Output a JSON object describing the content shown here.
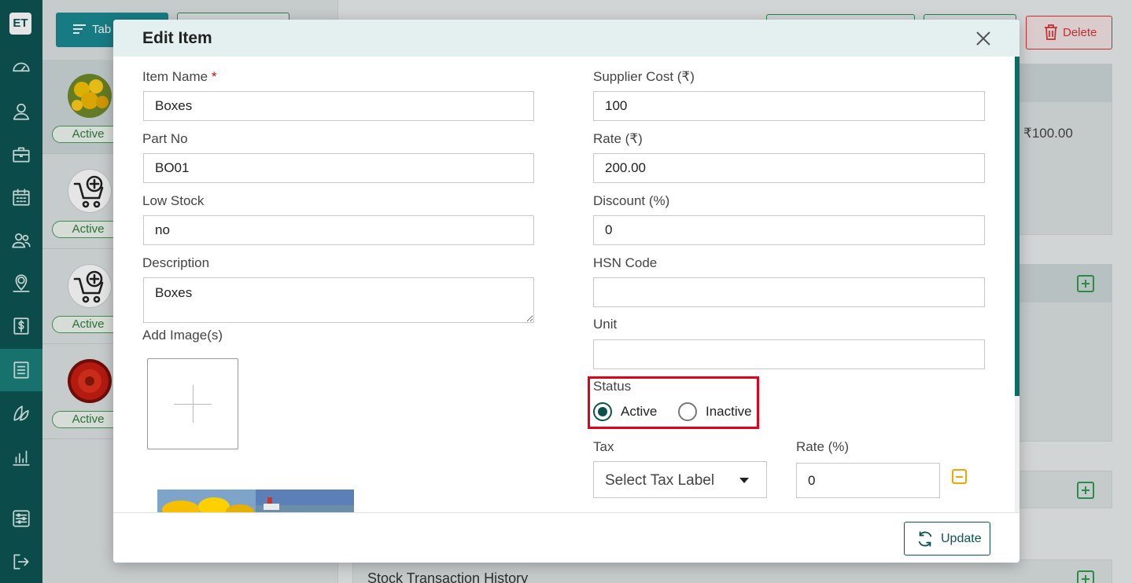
{
  "sidebar": {
    "logo": "ET",
    "icons": [
      "dashboard-icon",
      "user-icon",
      "briefcase-icon",
      "calendar-icon",
      "users-icon",
      "location-icon",
      "dollar-icon",
      "list-icon",
      "leaf-icon",
      "analytics-icon",
      "settings-icon",
      "logout-icon"
    ],
    "active": "list-icon"
  },
  "background": {
    "tab_button_label": "Tab",
    "delete_label": "Delete",
    "price": "₹100.00",
    "status_badges": [
      "Active",
      "Active",
      "Active",
      "Active"
    ],
    "bottom_section_title": "Stock Transaction History"
  },
  "modal": {
    "title": "Edit Item",
    "left": {
      "item_name": {
        "label": "Item Name",
        "required_mark": "*",
        "value": "Boxes"
      },
      "part_no": {
        "label": "Part No",
        "value": "BO01"
      },
      "low_stock": {
        "label": "Low Stock",
        "value": "no"
      },
      "description": {
        "label": "Description",
        "value": "Boxes"
      },
      "add_images_label": "Add Image(s)"
    },
    "right": {
      "supplier_cost": {
        "label": "Supplier Cost (₹)",
        "value": "100"
      },
      "rate": {
        "label": "Rate (₹)",
        "value": "200.00"
      },
      "discount": {
        "label": "Discount (%)",
        "value": "0"
      },
      "hsn_code": {
        "label": "HSN Code",
        "value": ""
      },
      "unit": {
        "label": "Unit",
        "value": ""
      },
      "status": {
        "label": "Status",
        "options": [
          "Active",
          "Inactive"
        ],
        "selected": "Active"
      },
      "tax": {
        "label": "Tax",
        "placeholder": "Select Tax Label"
      },
      "tax_rate": {
        "label": "Rate (%)",
        "value": "0"
      }
    },
    "footer": {
      "update_label": "Update"
    }
  },
  "colors": {
    "brand": "#0d5553",
    "status_highlight": "#e0001b",
    "success": "#2e9d4e",
    "danger": "#dd3333",
    "warning": "#f0a500"
  }
}
